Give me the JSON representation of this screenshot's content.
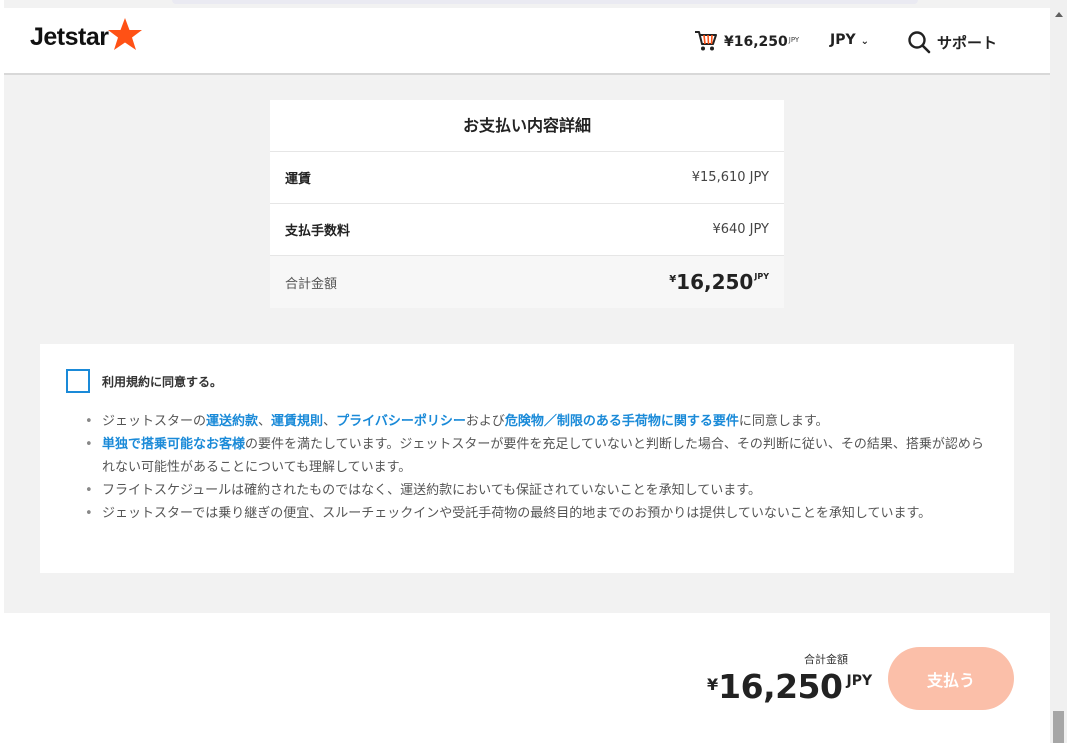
{
  "header": {
    "logo_text": "Jetstar",
    "cart_amount": "¥16,250",
    "cart_currency": "JPY",
    "currency_selector": "JPY",
    "support_label": "サポート"
  },
  "summary": {
    "title": "お支払い内容詳細",
    "rows": [
      {
        "label": "運賃",
        "value": "¥15,610 JPY"
      },
      {
        "label": "支払手数料",
        "value": "¥640 JPY"
      }
    ],
    "total_label": "合計金額",
    "total_yen": "¥",
    "total_amount": "16,250",
    "total_currency": "JPY"
  },
  "terms": {
    "agree_label": "利用規約に同意する。",
    "items": {
      "i1": {
        "t1": "ジェットスターの",
        "l1": "運送約款",
        "t2": "、",
        "l2": "運賃規則",
        "t3": "、",
        "l3": "プライバシーポリシー",
        "t4": "および",
        "l4": "危険物／制限のある手荷物に関する要件",
        "t5": "に同意します。"
      },
      "i2": {
        "l1": "単独で搭乗可能なお客様",
        "t1": "の要件を満たしています。ジェットスターが要件を充足していないと判断した場合、その判断に従い、その結果、搭乗が認められない可能性があることについても理解しています。"
      },
      "i3": "フライトスケジュールは確約されたものではなく、運送約款においても保証されていないことを承知しています。",
      "i4": "ジェットスターでは乗り継ぎの便宜、スルーチェックインや受託手荷物の最終目的地までのお預かりは提供していないことを承知しています。"
    }
  },
  "footer": {
    "total_label": "合計金額",
    "yen": "¥",
    "amount": "16,250",
    "currency": "JPY",
    "pay_button": "支払う"
  },
  "colors": {
    "brand_orange": "#ff5115",
    "link_blue": "#1a8ad8",
    "pay_button_disabled": "#fbbfa9"
  }
}
